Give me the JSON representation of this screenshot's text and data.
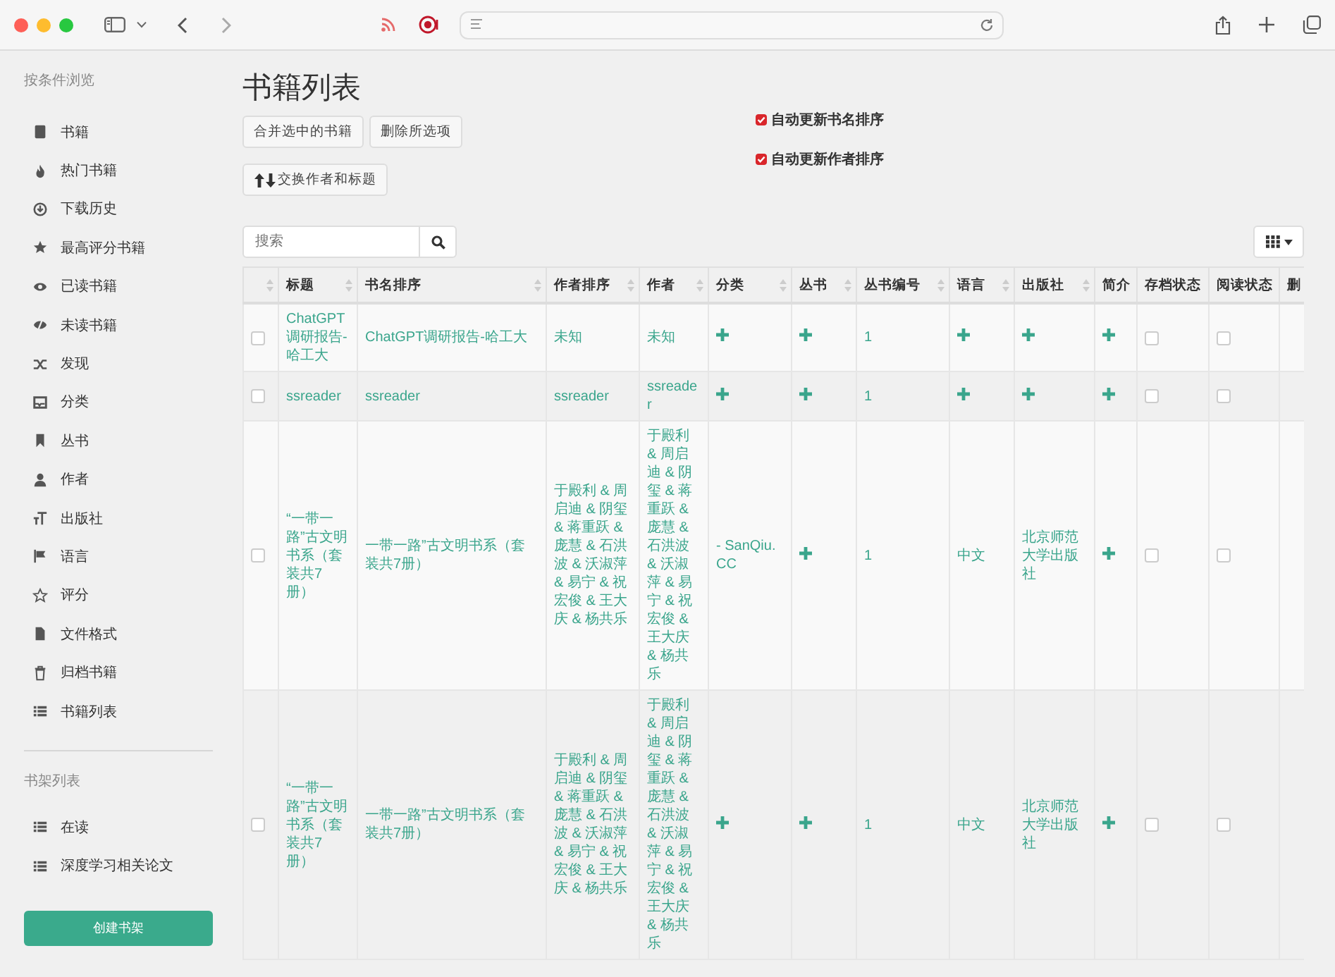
{
  "sidebar": {
    "heading": "按条件浏览",
    "items": [
      {
        "label": "书籍",
        "selected": false
      },
      {
        "label": "热门书籍",
        "selected": false
      },
      {
        "label": "下载历史",
        "selected": false
      },
      {
        "label": "最高评分书籍",
        "selected": false
      },
      {
        "label": "已读书籍",
        "selected": false
      },
      {
        "label": "未读书籍",
        "selected": false
      },
      {
        "label": "发现",
        "selected": false
      },
      {
        "label": "分类",
        "selected": false
      },
      {
        "label": "丛书",
        "selected": false
      },
      {
        "label": "作者",
        "selected": false
      },
      {
        "label": "出版社",
        "selected": false
      },
      {
        "label": "语言",
        "selected": false
      },
      {
        "label": "评分",
        "selected": false
      },
      {
        "label": "文件格式",
        "selected": false
      },
      {
        "label": "归档书籍",
        "selected": false
      },
      {
        "label": "书籍列表",
        "selected": false
      }
    ],
    "shelves_heading": "书架列表",
    "shelves": [
      {
        "label": "在读",
        "selected": false
      },
      {
        "label": "深度学习相关论文",
        "selected": false
      }
    ],
    "create_button": "创建书架"
  },
  "main": {
    "title": "书籍列表",
    "buttons": [
      "合并选中的书籍",
      "删除所选项"
    ],
    "swap_button": "交换作者和标题",
    "options": [
      {
        "label": "自动更新书名排序",
        "checked": true
      },
      {
        "label": "自动更新作者排序",
        "checked": true
      }
    ],
    "search": {
      "placeholder": "搜索"
    },
    "table": {
      "columns": [
        {
          "sortable": true
        },
        {
          "label": "标题",
          "sortable": true
        },
        {
          "label": "书名排序",
          "sortable": true
        },
        {
          "label": "作者排序",
          "sortable": true
        },
        {
          "label": "作者",
          "sortable": true
        },
        {
          "label": "分类",
          "sortable": true
        },
        {
          "label": "丛书",
          "sortable": true
        },
        {
          "label": "丛书编号",
          "sortable": true
        },
        {
          "label": "语言",
          "sortable": true
        },
        {
          "label": "出版社",
          "sortable": true
        },
        {
          "label": "简介",
          "sortable": false
        },
        {
          "label": "存档状态",
          "sortable": false
        },
        {
          "label": "阅读状态",
          "sortable": false
        },
        {
          "label": "删",
          "sortable": false
        }
      ],
      "rows": [
        {
          "cells": [
            {
              "kind": "check",
              "checked": false
            },
            {
              "kind": "text",
              "text": "ChatGPT调研报告-哈工大"
            },
            {
              "kind": "text",
              "text": "ChatGPT调研报告-哈工大"
            },
            {
              "kind": "text",
              "text": "未知"
            },
            {
              "kind": "text",
              "text": "未知"
            },
            {
              "kind": "add"
            },
            {
              "kind": "add"
            },
            {
              "kind": "text",
              "text": "1"
            },
            {
              "kind": "add"
            },
            {
              "kind": "add"
            },
            {
              "kind": "add"
            },
            {
              "kind": "check",
              "checked": false
            },
            {
              "kind": "check",
              "checked": false
            },
            {
              "kind": "empty"
            }
          ]
        },
        {
          "cells": [
            {
              "kind": "check",
              "checked": false
            },
            {
              "kind": "text",
              "text": "ssreader"
            },
            {
              "kind": "text",
              "text": "ssreader"
            },
            {
              "kind": "text",
              "text": "ssreader"
            },
            {
              "kind": "text",
              "text": "ssreader"
            },
            {
              "kind": "add"
            },
            {
              "kind": "add"
            },
            {
              "kind": "text",
              "text": "1"
            },
            {
              "kind": "add"
            },
            {
              "kind": "add"
            },
            {
              "kind": "add"
            },
            {
              "kind": "check",
              "checked": false
            },
            {
              "kind": "check",
              "checked": false
            },
            {
              "kind": "empty"
            }
          ]
        },
        {
          "cells": [
            {
              "kind": "check",
              "checked": false
            },
            {
              "kind": "text",
              "text": "“一带一路”古文明书系（套装共7册）"
            },
            {
              "kind": "text",
              "text": "一带一路”古文明书系（套装共7册）"
            },
            {
              "kind": "text",
              "text": "于殿利 & 周启迪 & 阴玺 & 蒋重跃 & 庞慧 & 石洪波 & 沃淑萍 & 易宁 & 祝宏俊 & 王大庆 & 杨共乐"
            },
            {
              "kind": "text",
              "text": "于殿利 & 周启迪 & 阴玺 & 蒋重跃 & 庞慧 & 石洪波 & 沃淑萍 & 易宁 & 祝宏俊 & 王大庆 & 杨共乐"
            },
            {
              "kind": "text",
              "text": "- SanQiu.CC"
            },
            {
              "kind": "add"
            },
            {
              "kind": "text",
              "text": "1"
            },
            {
              "kind": "text",
              "text": "中文"
            },
            {
              "kind": "text",
              "text": "北京师范大学出版社"
            },
            {
              "kind": "add"
            },
            {
              "kind": "check",
              "checked": false
            },
            {
              "kind": "check",
              "checked": false
            },
            {
              "kind": "empty"
            }
          ]
        },
        {
          "cells": [
            {
              "kind": "check",
              "checked": false
            },
            {
              "kind": "text",
              "text": "“一带一路”古文明书系（套装共7册）"
            },
            {
              "kind": "text",
              "text": "一带一路”古文明书系（套装共7册）"
            },
            {
              "kind": "text",
              "text": "于殿利 & 周启迪 & 阴玺 & 蒋重跃 & 庞慧 & 石洪波 & 沃淑萍 & 易宁 & 祝宏俊 & 王大庆 & 杨共乐"
            },
            {
              "kind": "text",
              "text": "于殿利 & 周启迪 & 阴玺 & 蒋重跃 & 庞慧 & 石洪波 & 沃淑萍 & 易宁 & 祝宏俊 & 王大庆 & 杨共乐"
            },
            {
              "kind": "add"
            },
            {
              "kind": "add"
            },
            {
              "kind": "text",
              "text": "1"
            },
            {
              "kind": "text",
              "text": "中文"
            },
            {
              "kind": "text",
              "text": "北京师范大学出版社"
            },
            {
              "kind": "add"
            },
            {
              "kind": "check",
              "checked": false
            },
            {
              "kind": "check",
              "checked": false
            },
            {
              "kind": "empty"
            }
          ]
        }
      ]
    }
  }
}
